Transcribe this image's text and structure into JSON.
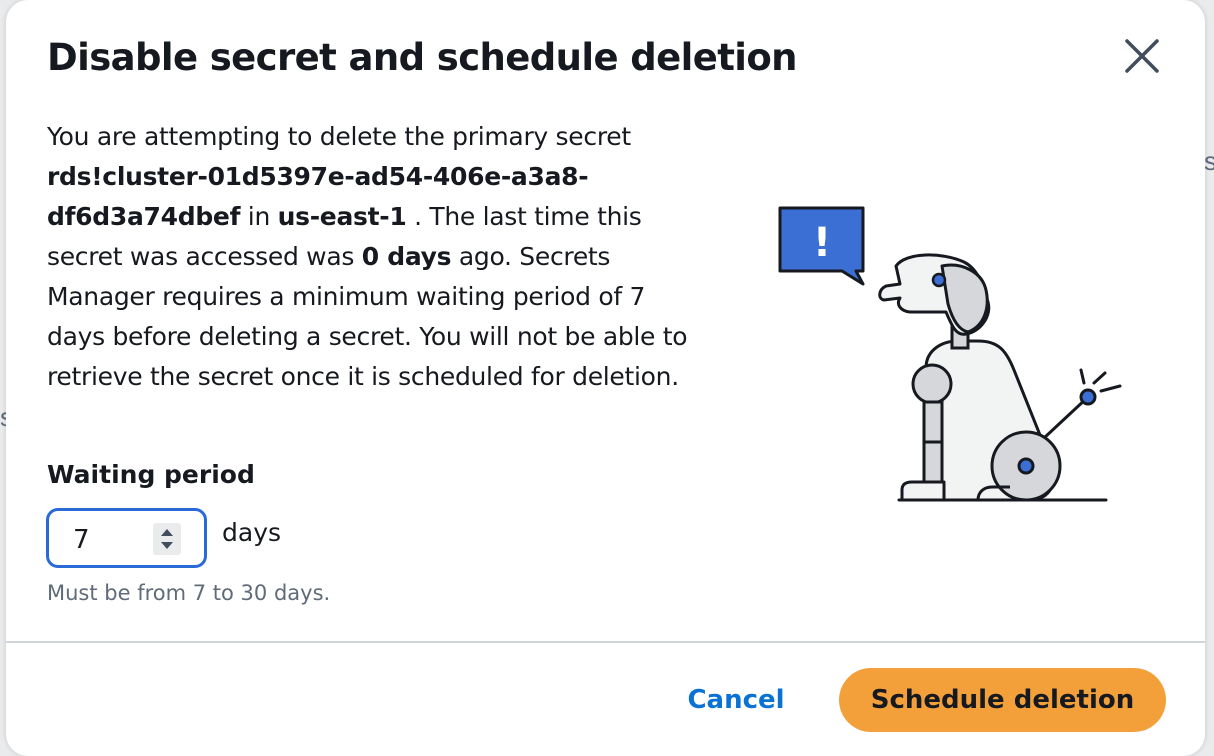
{
  "modal": {
    "title": "Disable secret and schedule deletion",
    "close_icon": "close-icon",
    "body": {
      "part1": "You are attempting to delete the primary secret ",
      "secret_name": "rds!cluster-01d5397e-ad54-406e-a3a8-df6d3a74dbef",
      "part2": " in ",
      "region": "us-east-1",
      "part3": " . The last time this secret was accessed was ",
      "last_accessed": "0 days",
      "part4": " ago. Secrets Manager requires a minimum waiting period of 7 days before deleting a secret. You will not be able to retrieve the secret once it is scheduled for deletion."
    },
    "waiting_period": {
      "label": "Waiting period",
      "value": "7",
      "unit": "days",
      "constraint": "Must be from 7 to 30 days."
    },
    "illustration": {
      "alert_icon": "exclamation-icon",
      "alert_text": "!",
      "accent_color": "#3b6fd4"
    },
    "footer": {
      "cancel_label": "Cancel",
      "submit_label": "Schedule deletion"
    }
  },
  "colors": {
    "primary_button": "#f4a03a",
    "link": "#0972d3",
    "focus_border": "#2a6ad6"
  }
}
